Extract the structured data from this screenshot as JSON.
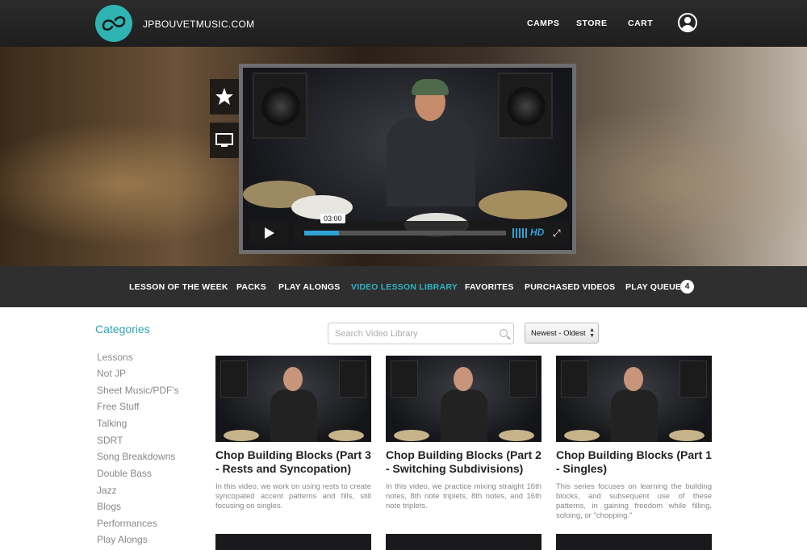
{
  "header": {
    "site_name": "JPBOUVETMUSIC.COM",
    "nav": [
      "CAMPS",
      "STORE",
      "CART"
    ]
  },
  "player": {
    "time_tooltip": "03:00",
    "hd_label": "HD",
    "progress": 0.17
  },
  "subnav": {
    "items": [
      "LESSON OF THE WEEK",
      "PACKS",
      "PLAY ALONGS",
      "VIDEO LESSON LIBRARY",
      "FAVORITES",
      "PURCHASED VIDEOS",
      "PLAY QUEUE"
    ],
    "active": "VIDEO LESSON LIBRARY",
    "queue_count": "4"
  },
  "sidebar": {
    "title": "Categories",
    "items": [
      "Lessons",
      "Not JP",
      "Sheet Music/PDF's",
      "Free Stuff",
      "Talking",
      "SDRT",
      "Song Breakdowns",
      "Double Bass",
      "Jazz",
      "Blogs",
      "Performances",
      "Play Alongs"
    ]
  },
  "search": {
    "placeholder": "Search Video Library"
  },
  "sort": {
    "selected": "Newest - Oldest"
  },
  "cards": [
    {
      "title": "Chop Building Blocks (Part 3 - Rests and Syncopation)",
      "description": "In this video, we work on using rests to create syncopated accent patterns and fills, still focusing on singles."
    },
    {
      "title": "Chop Building Blocks (Part 2 - Switching Subdivisions)",
      "description": "In this video, we practice mixing straight 16th notes, 8th note triplets, 8th notes, and 16th note triplets."
    },
    {
      "title": "Chop Building Blocks (Part 1 - Singles)",
      "description": "This series focuses on learning the building blocks, and subsequent use of these patterns, in gaining freedom while filling, soloing, or \"chopping.\""
    }
  ],
  "colors": {
    "accent": "#2fb3c3",
    "progress": "#2fa3d6"
  }
}
